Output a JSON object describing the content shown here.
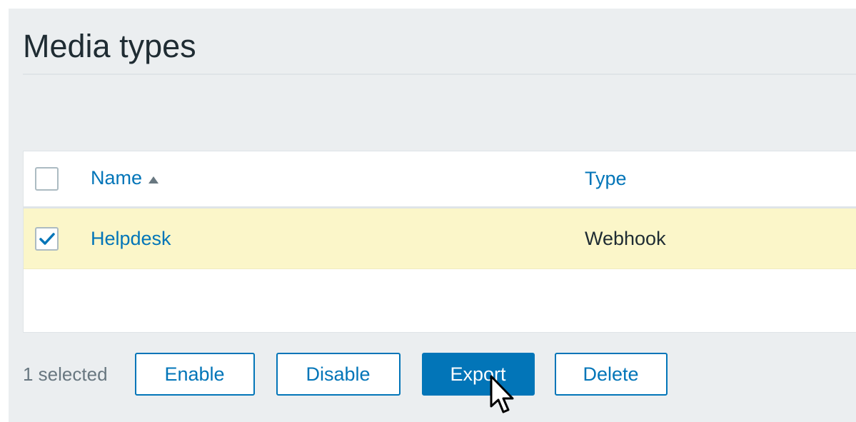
{
  "page": {
    "title": "Media types"
  },
  "table": {
    "columns": {
      "name": "Name",
      "type": "Type"
    },
    "rows": [
      {
        "name": "Helpdesk",
        "type": "Webhook",
        "checked": true
      }
    ]
  },
  "actions": {
    "selected_text": "1 selected",
    "enable_label": "Enable",
    "disable_label": "Disable",
    "export_label": "Export",
    "delete_label": "Delete"
  },
  "colors": {
    "accent": "#0275b8",
    "selected_row": "#fbf6c9",
    "page_bg": "#ebeef0"
  },
  "icons": {
    "sort": "sort-ascending-icon",
    "check": "checkmark-icon",
    "cursor": "mouse-pointer-icon"
  }
}
